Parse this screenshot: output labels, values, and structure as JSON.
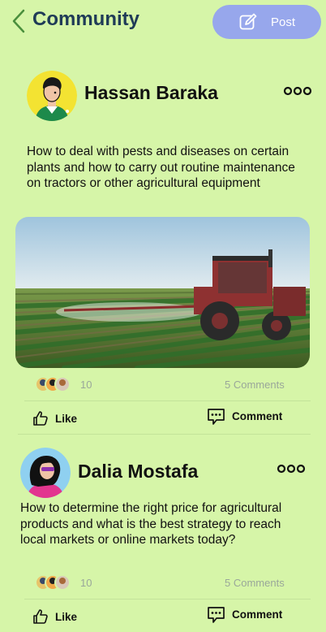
{
  "header": {
    "title": "Community",
    "post_label": "Post"
  },
  "posts": [
    {
      "author": "Hassan Baraka",
      "text": "How to deal with pests and diseases on certain plants and how to carry out routine maintenance  on tractors or other agricultural equipment",
      "likes": "10",
      "comments": "5 Comments",
      "like_label": "Like",
      "comment_label": "Comment"
    },
    {
      "author": "Dalia Mostafa",
      "text": "How to determine the right price for agricultural products and what is the best strategy to reach local markets or online markets today?",
      "likes": "10",
      "comments": "5 Comments",
      "like_label": "Like",
      "comment_label": "Comment"
    }
  ],
  "colors": {
    "background": "#d6f5a8",
    "accent": "#97a7ec",
    "title": "#1f3b57"
  }
}
